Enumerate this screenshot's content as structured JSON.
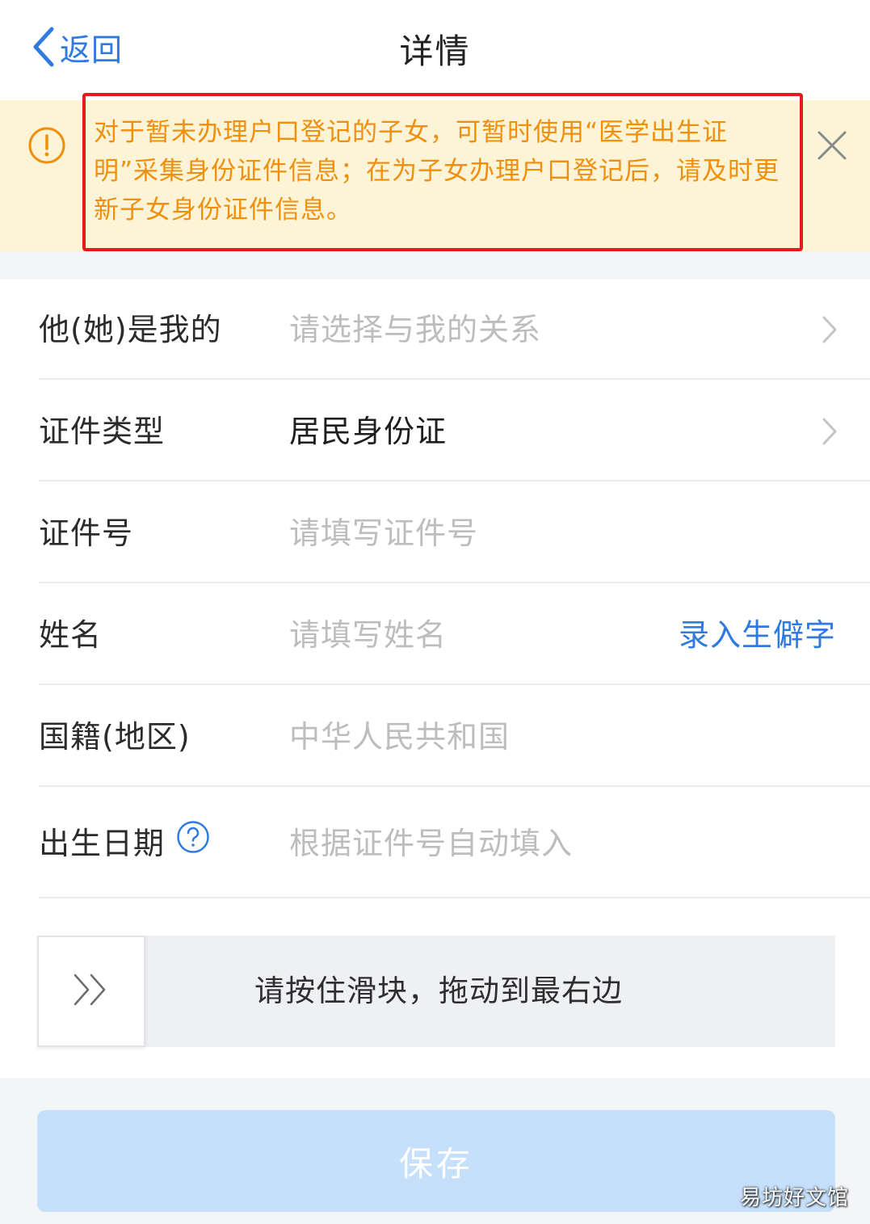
{
  "header": {
    "back_label": "返回",
    "title": "详情"
  },
  "notice": {
    "text": "对于暂未办理户口登记的子女，可暂时使用“医学出生证明”采集身份证件信息；在为子女办理户口登记后，请及时更新子女身份证件信息。"
  },
  "form": {
    "relation": {
      "label": "他(她)是我的",
      "placeholder": "请选择与我的关系"
    },
    "id_type": {
      "label": "证件类型",
      "value": "居民身份证"
    },
    "id_number": {
      "label": "证件号",
      "placeholder": "请填写证件号"
    },
    "name": {
      "label": "姓名",
      "placeholder": "请填写姓名",
      "rare_char_link": "录入生僻字"
    },
    "nationality": {
      "label": "国籍(地区)",
      "value": "中华人民共和国"
    },
    "birth_date": {
      "label": "出生日期",
      "placeholder": "根据证件号自动填入"
    }
  },
  "slider": {
    "hint": "请按住滑块，拖动到最右边"
  },
  "save_label": "保存",
  "watermark": "易坊好文馆",
  "colors": {
    "accent_blue": "#2f7be0",
    "notice_orange": "#ef8f0c",
    "notice_bg": "#fdf4d8",
    "highlight_red": "#e21c1c",
    "save_disabled": "#c6e0fb"
  }
}
